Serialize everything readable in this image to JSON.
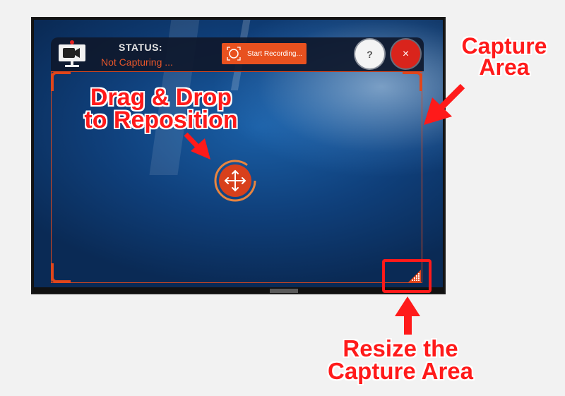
{
  "toolbar": {
    "status_title": "STATUS:",
    "status_value": "Not Capturing ...",
    "start_recording_label": "Start Recording...",
    "help_label": "?",
    "close_label": "×"
  },
  "annotations": {
    "capture_area_line1": "Capture",
    "capture_area_line2": "Area",
    "drag_line1": "Drag & Drop",
    "drag_line2": "to Reposition",
    "resize_line1": "Resize the",
    "resize_line2": "Capture Area"
  },
  "icons": {
    "camera": "video-camera-monitor-icon",
    "record": "record-target-icon",
    "move": "four-arrows-move-icon",
    "resize": "resize-grip-icon"
  },
  "colors": {
    "accent": "#e8511f",
    "close": "#d9241c",
    "annotation": "#ff1a1a",
    "frame": "#d8471f"
  }
}
